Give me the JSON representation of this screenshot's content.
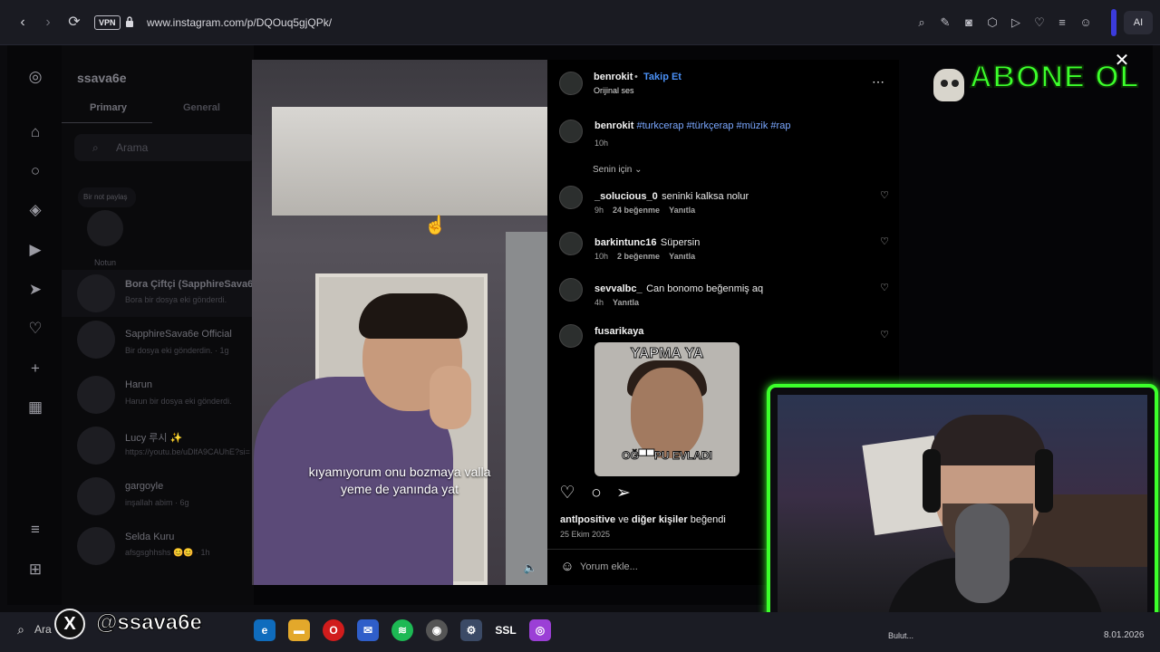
{
  "browser": {
    "vpn_label": "VPN",
    "url": "www.instagram.com/p/DQOuq5gjQPk/",
    "ai_label": "AI"
  },
  "dm": {
    "username": "ssava6e",
    "tabs": [
      "Primary",
      "General"
    ],
    "search_placeholder": "Arama",
    "note_bubble": "Bir not paylaş",
    "note_label": "Notun",
    "threads": [
      {
        "name": "Bora Çiftçi (SapphireSava6e)",
        "sub": "Bora bir dosya eki gönderdi."
      },
      {
        "name": "SapphireSava6e Official",
        "sub": "Bir dosya eki gönderdin. · 1g"
      },
      {
        "name": "Harun",
        "sub": "Harun bir dosya eki gönderdi."
      },
      {
        "name": "Lucy 루시 ✨",
        "sub": "https://youtu.be/uDlfA9CAUhE?si="
      },
      {
        "name": "gargoyle",
        "sub": "inşallah abim · 6g"
      },
      {
        "name": "Selda Kuru",
        "sub": "afsgsghhshs 😊😊 · 1h"
      }
    ]
  },
  "video": {
    "caption_line1": "kıyamıyorum onu bozmaya valla",
    "caption_line2": "yeme de yanında yat"
  },
  "post": {
    "author": "benrokit",
    "follow_label": "Takip Et",
    "audio": "Orijinal ses",
    "caption_user": "benrokit",
    "caption_tags": "#turkcerap #türkçerap #müzik #rap",
    "caption_time": "10h",
    "sort_label": "Senin için",
    "comments": [
      {
        "user": "_solucious_0",
        "text": "seninki kalksa nolur",
        "time": "9h",
        "likes": "24 beğenme",
        "reply": "Yanıtla"
      },
      {
        "user": "barkintunc16",
        "text": "Süpersin",
        "time": "10h",
        "likes": "2 beğenme",
        "reply": "Yanıtla"
      },
      {
        "user": "sevvalbc_",
        "text": "Can bonomo beğenmiş aq",
        "time": "4h",
        "likes": "",
        "reply": "Yanıtla"
      },
      {
        "user": "fusarikaya",
        "text": "",
        "time": "",
        "likes": "",
        "reply": ""
      }
    ],
    "meme_top": "YAPMA YA",
    "meme_bottom": "OĞ▀▀PU EVLADI",
    "liked_by_user": "antlpositive",
    "liked_by_mid": "ve",
    "liked_by_rest": "diğer kişiler",
    "liked_by_suffix": "beğendi",
    "date": "25 Ekim 2025",
    "comment_placeholder": "Yorum ekle..."
  },
  "overlay": {
    "abone_text": "ABONE OL",
    "handle": "@ssava6e"
  },
  "taskbar": {
    "search_label": "Ara",
    "ssl_label": "SSL",
    "tray_text": "Bulut...",
    "date": "8.01.2026"
  },
  "icons": {
    "back": "chevron-left-icon",
    "forward": "chevron-right-icon",
    "reload": "reload-icon",
    "instagram": "instagram-logo-icon",
    "home": "home-icon",
    "search": "search-icon",
    "explore": "compass-icon",
    "reels": "reels-icon",
    "messages": "send-icon",
    "notifications": "heart-icon",
    "create": "plus-icon",
    "dashboard": "chart-icon",
    "more": "menu-icon",
    "also": "apps-icon"
  },
  "colors": {
    "accent_blue": "#4a90f5",
    "overlay_green": "#3cff2b",
    "background": "#000000"
  }
}
